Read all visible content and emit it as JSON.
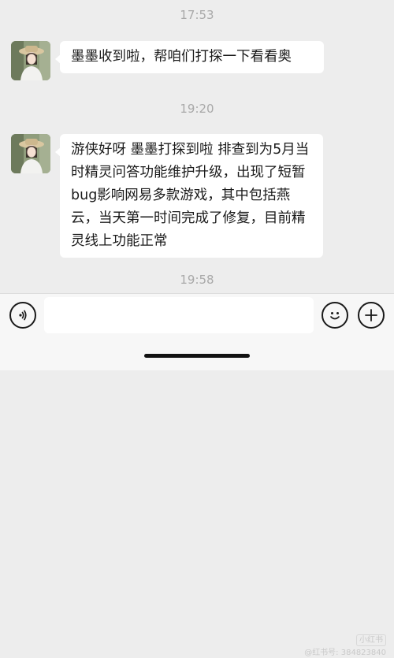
{
  "conversation": {
    "messages": [
      {
        "time": "17:53",
        "text": "墨墨收到啦，帮咱们打探一下看看奥"
      },
      {
        "time": "19:20",
        "text": "游侠好呀 墨墨打探到啦 排查到为5月当时精灵问答功能维护升级，出现了短暂 bug影响网易多款游戏，其中包括燕云，当天第一时间完成了修复，目前精灵线上功能正常"
      }
    ],
    "trailing_time": "19:58"
  },
  "input_bar": {
    "voice_icon": "voice-icon",
    "emoji_icon": "emoji-icon",
    "plus_icon": "plus-icon",
    "input_value": ""
  },
  "watermark": {
    "badge": "小红书",
    "id_line": "@红书号: 384823840"
  }
}
